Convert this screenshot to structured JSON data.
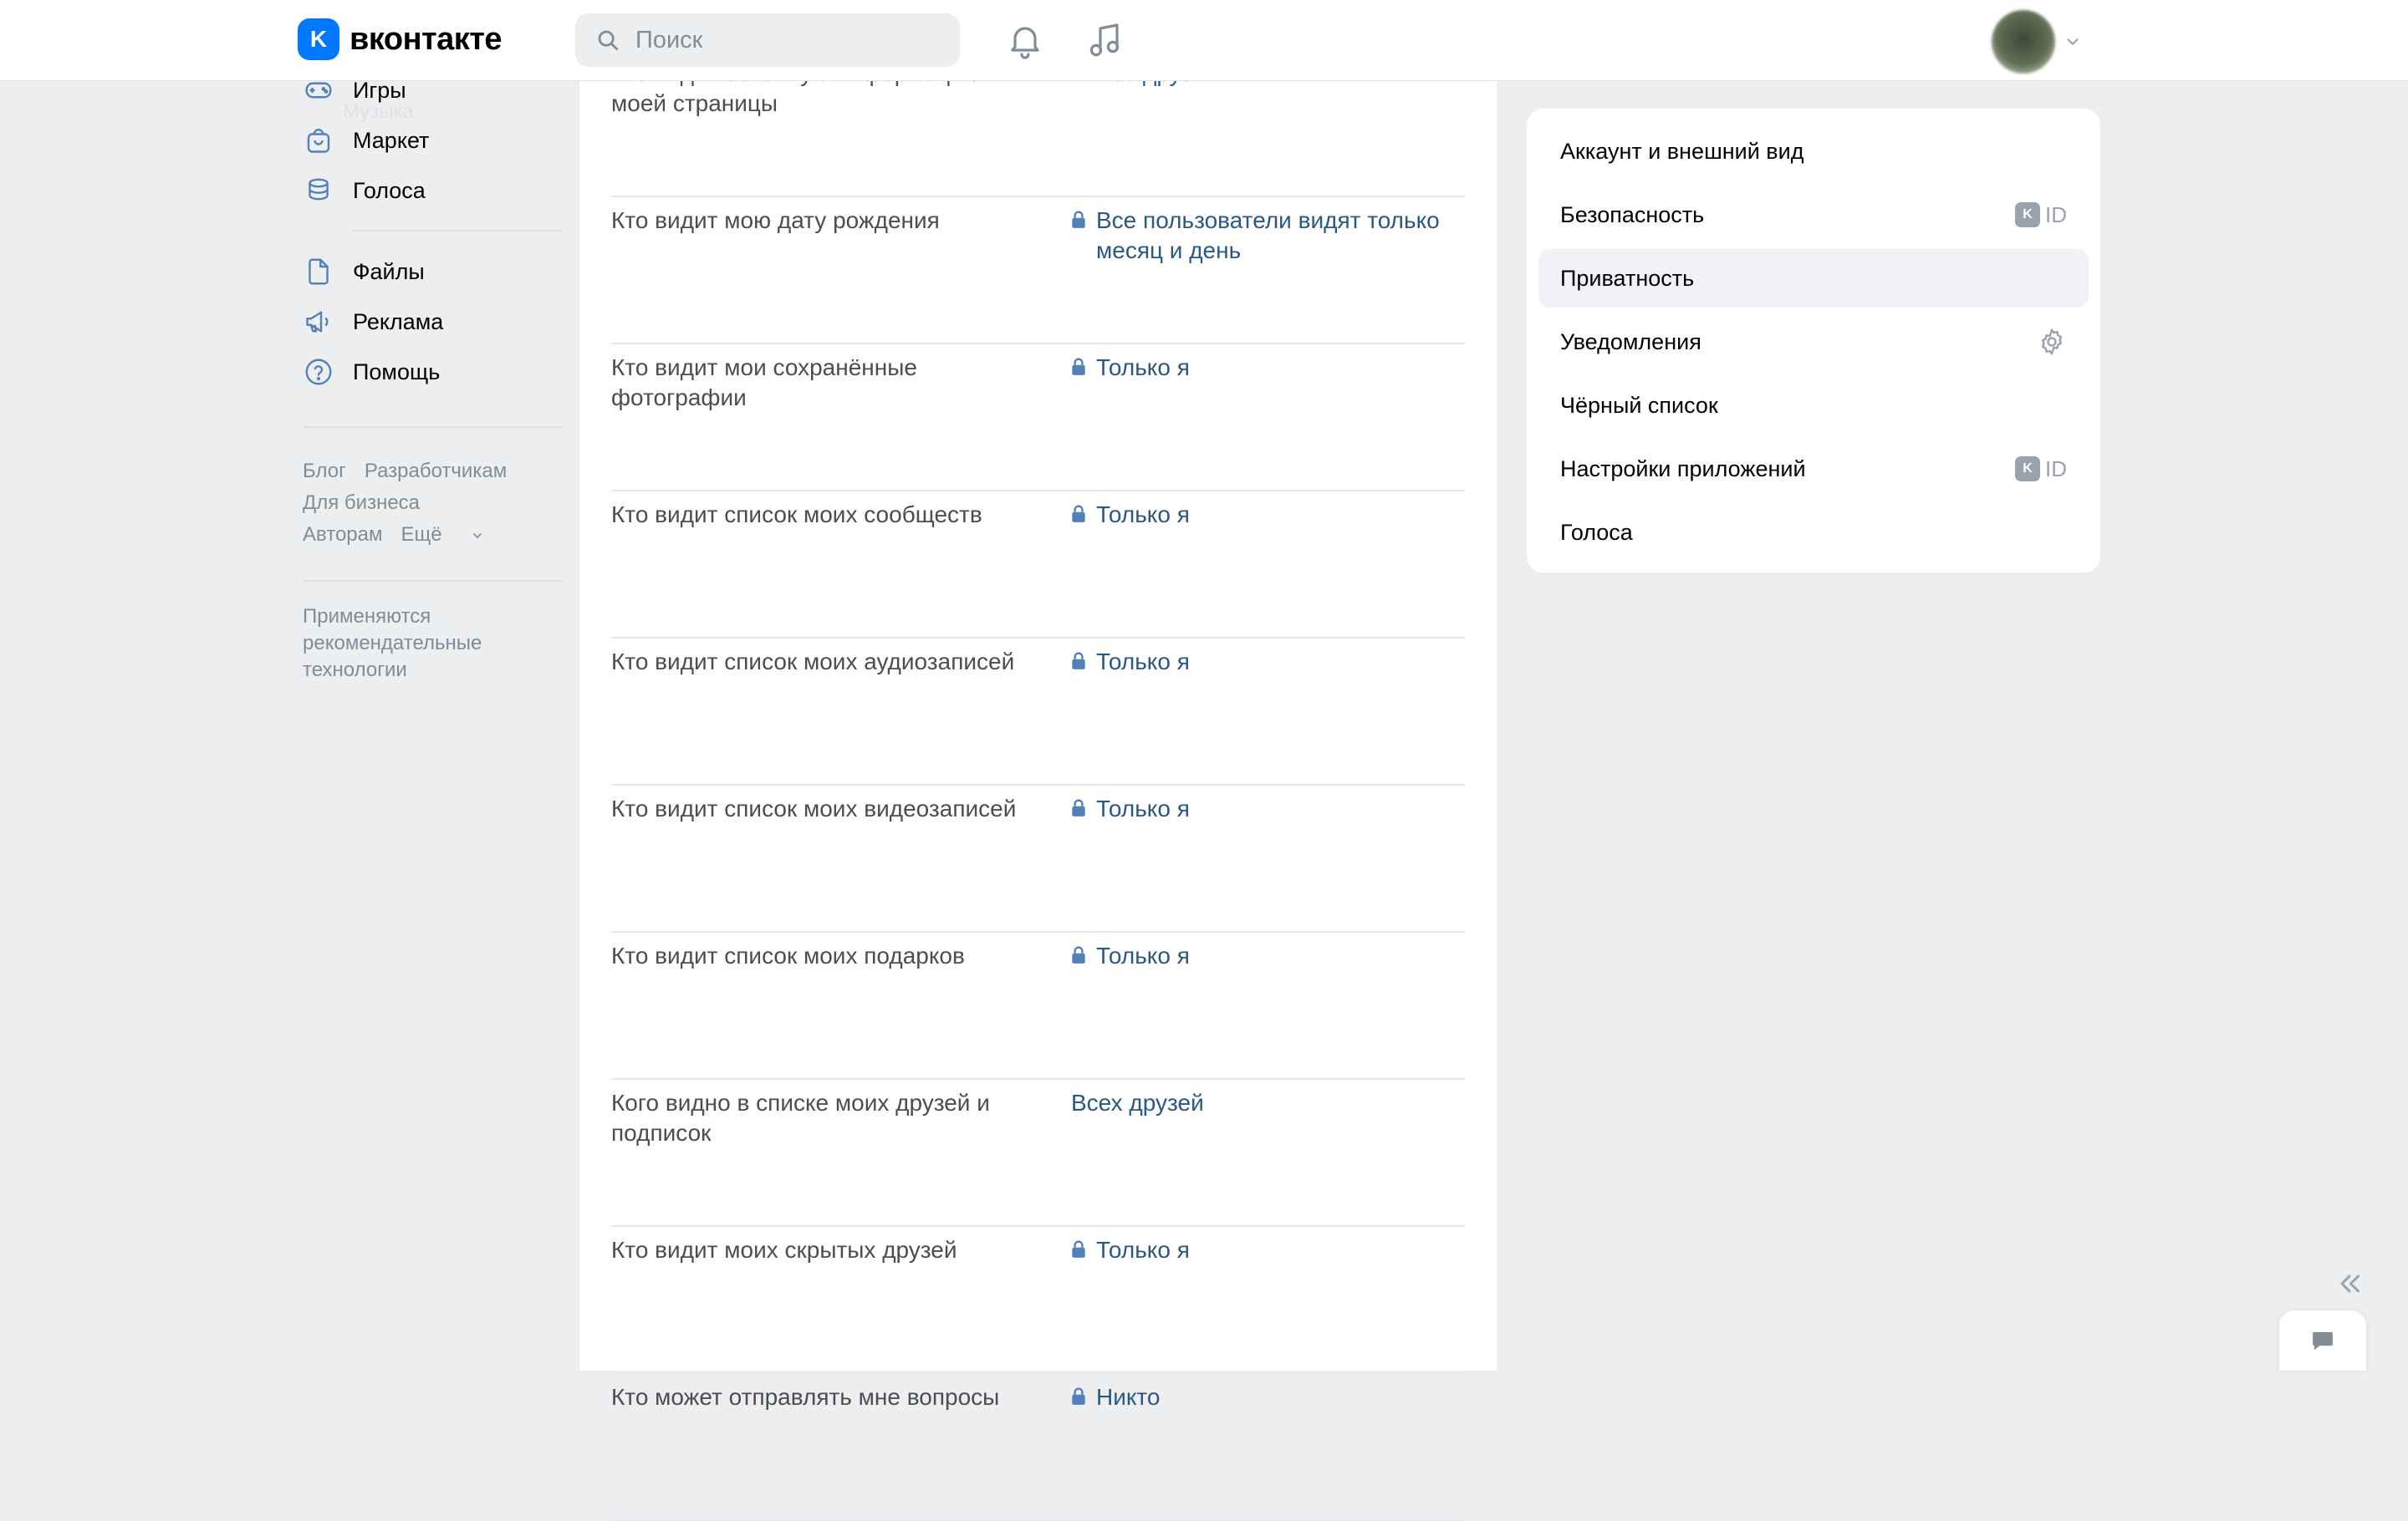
{
  "header": {
    "logo_text": "вконтакте",
    "logo_mark": "K",
    "search_placeholder": "Поиск",
    "icons": [
      "search-icon",
      "bell-icon",
      "music-icon",
      "chevron-down-icon"
    ]
  },
  "left_nav": {
    "ghost_label": "Музыка",
    "items": [
      {
        "label": "Игры",
        "icon": "gamepad-icon"
      },
      {
        "label": "Маркет",
        "icon": "shopping-bag-icon"
      },
      {
        "label": "Голоса",
        "icon": "coins-icon"
      },
      {
        "label": "Файлы",
        "icon": "file-icon"
      },
      {
        "label": "Реклама",
        "icon": "megaphone-icon"
      },
      {
        "label": "Помощь",
        "icon": "help-circle-icon"
      }
    ],
    "footer_links": {
      "blog": "Блог",
      "developers": "Разработчикам",
      "business": "Для бизнеса",
      "authors": "Авторам",
      "more": "Ещё"
    },
    "footer_note": "Применяются рекомендательные технологии"
  },
  "privacy_rows": [
    {
      "question": "Кто видит основную информацию моей страницы",
      "value": "Все друзья",
      "locked": true
    },
    {
      "question": "Кто видит мою дату рождения",
      "value": "Все пользователи видят только месяц и день",
      "locked": true
    },
    {
      "question": "Кто видит мои сохранённые фотографии",
      "value": "Только я",
      "locked": true
    },
    {
      "question": "Кто видит список моих сообществ",
      "value": "Только я",
      "locked": true
    },
    {
      "question": "Кто видит список моих аудиозаписей",
      "value": "Только я",
      "locked": true
    },
    {
      "question": "Кто видит список моих видеозаписей",
      "value": "Только я",
      "locked": true
    },
    {
      "question": "Кто видит список моих подарков",
      "value": "Только я",
      "locked": true
    },
    {
      "question": "Кого видно в списке моих друзей и подписок",
      "value": "Всех друзей",
      "locked": false
    },
    {
      "question": "Кто видит моих скрытых друзей",
      "value": "Только я",
      "locked": true
    },
    {
      "question": "Кто может отправлять мне вопросы",
      "value": "Никто",
      "locked": true
    }
  ],
  "settings_menu": {
    "items": [
      {
        "label": "Аккаунт и внешний вид",
        "badge": ""
      },
      {
        "label": "Безопасность",
        "badge": "ID"
      },
      {
        "label": "Приватность",
        "badge": "",
        "active": true
      },
      {
        "label": "Уведомления",
        "badge": ""
      },
      {
        "label": "Чёрный список",
        "badge": ""
      },
      {
        "label": "Настройки приложений",
        "badge": "ID"
      },
      {
        "label": "Голоса",
        "badge": ""
      }
    ],
    "vkid_mark": "K"
  },
  "colors": {
    "accent": "#0077ff",
    "link": "#2a5885",
    "page_bg": "#edeef0",
    "secondary_text": "#818c99"
  }
}
